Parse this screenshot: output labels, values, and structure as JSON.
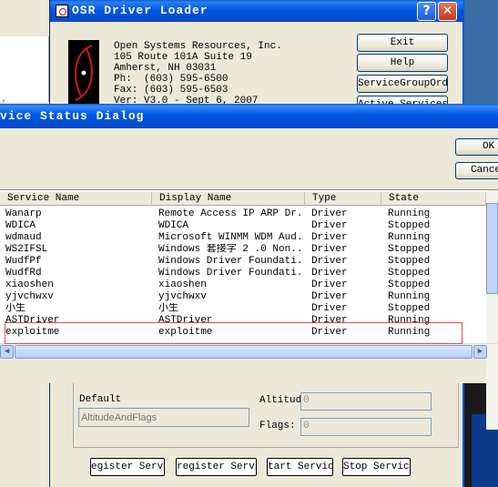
{
  "osr_window": {
    "title": "OSR Driver Loader",
    "help_caption": "?",
    "close_caption": "✕",
    "address": [
      "Open Systems Resources, Inc.",
      "105 Route 101A Suite 19",
      "Amherst, NH 03031",
      "Ph:  (603) 595-6500",
      "Fax: (603) 595-6503",
      "Ver: V3.0 - Sept 6, 2007"
    ],
    "buttons": [
      "Exit",
      "Help",
      "ServiceGroupOrder",
      "Active Services"
    ],
    "default_label": "Default",
    "altitude_placeholder": "AltitudeAndFlags",
    "altitud_label": "Altitud",
    "flags_label": "Flags:",
    "altitud_value": "0",
    "flags_value": "0",
    "bottom_buttons": [
      "Register Service",
      "Unregister Service",
      "Start Service",
      "Stop Service"
    ],
    "bottom_buttons_visible": [
      "egister Servic",
      "register Servi",
      "tart Service",
      "Stop Service"
    ]
  },
  "dialog": {
    "title": "vice Status Dialog",
    "ok_label": "OK",
    "cancel_label": "Cancel",
    "columns": [
      "Service Name",
      "Display Name",
      "Type",
      "State"
    ],
    "rows": [
      [
        "Wanarp",
        "Remote Access IP ARP Dr...",
        "Driver",
        "Running"
      ],
      [
        "WDICA",
        "WDICA",
        "Driver",
        "Stopped"
      ],
      [
        "wdmaud",
        "Microsoft WINMM WDM Aud...",
        "Driver",
        "Running"
      ],
      [
        "WS2IFSL",
        "Windows 套接字 2 .0 Non...",
        "Driver",
        "Stopped"
      ],
      [
        "WudfPf",
        "Windows Driver Foundati...",
        "Driver",
        "Stopped"
      ],
      [
        "WudfRd",
        "Windows Driver Foundati...",
        "Driver",
        "Stopped"
      ],
      [
        "xiaoshen",
        "xiaoshen",
        "Driver",
        "Stopped"
      ],
      [
        "yjvchwxv",
        "yjvchwxv",
        "Driver",
        "Running"
      ],
      [
        "小生",
        "小生",
        "Driver",
        "Stopped"
      ],
      [
        "ASTDriver",
        "ASTDriver",
        "Driver",
        "Running"
      ],
      [
        "exploitme",
        "exploitme",
        "Driver",
        "Running"
      ]
    ],
    "highlighted_row": "exploitme"
  },
  "colors": {
    "titlebar_blue": "#0058e6",
    "window_bg": "#ece9d8",
    "close_red": "#c0391a",
    "highlight_border": "#e05050"
  }
}
